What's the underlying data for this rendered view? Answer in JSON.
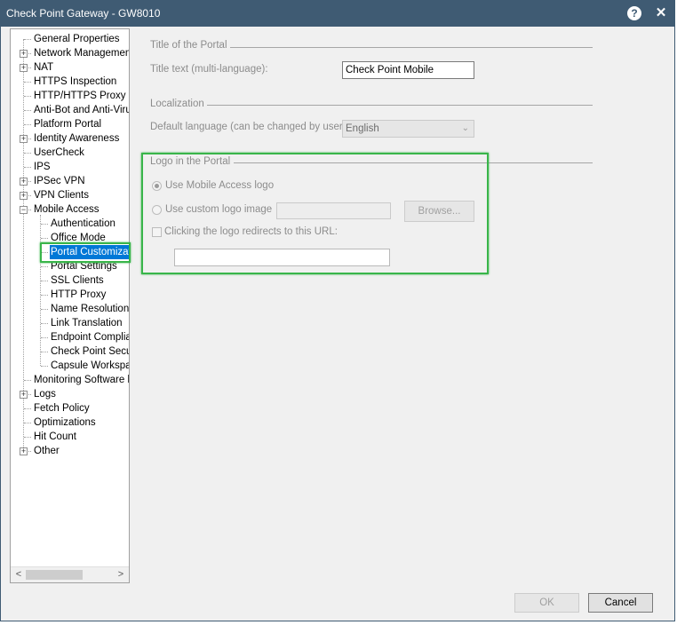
{
  "window": {
    "title": "Check Point Gateway - GW8010",
    "help_glyph": "?",
    "close_glyph": "✕"
  },
  "tree": {
    "items": [
      {
        "label": "General Properties",
        "level": 0,
        "expander": false
      },
      {
        "label": "Network Management",
        "level": 0,
        "expander": true
      },
      {
        "label": "NAT",
        "level": 0,
        "expander": true
      },
      {
        "label": "HTTPS Inspection",
        "level": 0,
        "expander": false
      },
      {
        "label": "HTTP/HTTPS Proxy",
        "level": 0,
        "expander": false
      },
      {
        "label": "Anti-Bot and Anti-Virus",
        "level": 0,
        "expander": false
      },
      {
        "label": "Platform Portal",
        "level": 0,
        "expander": false
      },
      {
        "label": "Identity Awareness",
        "level": 0,
        "expander": true
      },
      {
        "label": "UserCheck",
        "level": 0,
        "expander": false
      },
      {
        "label": "IPS",
        "level": 0,
        "expander": false
      },
      {
        "label": "IPSec VPN",
        "level": 0,
        "expander": true
      },
      {
        "label": "VPN Clients",
        "level": 0,
        "expander": true
      },
      {
        "label": "Mobile Access",
        "level": 0,
        "expander": true,
        "expanded": true
      },
      {
        "label": "Authentication",
        "level": 1,
        "expander": false
      },
      {
        "label": "Office Mode",
        "level": 1,
        "expander": false
      },
      {
        "label": "Portal Customizatic",
        "level": 1,
        "expander": false,
        "selected": true
      },
      {
        "label": "Portal Settings",
        "level": 1,
        "expander": false
      },
      {
        "label": "SSL Clients",
        "level": 1,
        "expander": false
      },
      {
        "label": "HTTP Proxy",
        "level": 1,
        "expander": false
      },
      {
        "label": "Name Resolution",
        "level": 1,
        "expander": false
      },
      {
        "label": "Link Translation",
        "level": 1,
        "expander": false
      },
      {
        "label": "Endpoint Complian",
        "level": 1,
        "expander": false
      },
      {
        "label": "Check Point Secur",
        "level": 1,
        "expander": false
      },
      {
        "label": "Capsule Workspac",
        "level": 1,
        "expander": false
      },
      {
        "label": "Monitoring Software bla",
        "level": 0,
        "expander": false
      },
      {
        "label": "Logs",
        "level": 0,
        "expander": true
      },
      {
        "label": "Fetch Policy",
        "level": 0,
        "expander": false
      },
      {
        "label": "Optimizations",
        "level": 0,
        "expander": false
      },
      {
        "label": "Hit Count",
        "level": 0,
        "expander": false
      },
      {
        "label": "Other",
        "level": 0,
        "expander": true
      }
    ],
    "scroll_left": "<",
    "scroll_right": ">"
  },
  "portal_title": {
    "section_title": "Title of the Portal",
    "field_label": "Title text (multi-language):",
    "value": "Check Point Mobile"
  },
  "localization": {
    "section_title": "Localization",
    "field_label": "Default language (can be changed by user):",
    "value": "English"
  },
  "logo": {
    "section_title": "Logo in the Portal",
    "use_mobile_logo_label": "Use Mobile Access logo",
    "use_mobile_logo_selected": true,
    "use_custom_logo_label": "Use custom logo image",
    "custom_logo_path": "",
    "browse_label": "Browse...",
    "redirect_label": "Clicking the logo redirects to this URL:",
    "redirect_checked": false,
    "redirect_url": ""
  },
  "footer": {
    "ok_label": "OK",
    "cancel_label": "Cancel"
  },
  "colors": {
    "titlebar": "#3f5b73",
    "selection": "#0078d7",
    "highlight": "#39b54a"
  }
}
